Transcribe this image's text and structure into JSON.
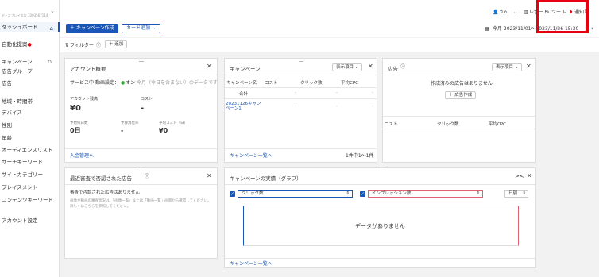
{
  "sidebar": {
    "account_id": "ディスプレイ広告 1003567114",
    "items": [
      {
        "label": "ダッシュボード"
      },
      {
        "label": "自動化提案"
      },
      {
        "label": "キャンペーン"
      },
      {
        "label": "広告グループ"
      },
      {
        "label": "広告"
      },
      {
        "label": "地域・時間帯"
      },
      {
        "label": "デバイス"
      },
      {
        "label": "性別"
      },
      {
        "label": "年齢"
      },
      {
        "label": "オーディエンスリスト"
      },
      {
        "label": "サーチキーワード"
      },
      {
        "label": "サイトカテゴリー"
      },
      {
        "label": "プレイスメント"
      },
      {
        "label": "コンテンツキーワード"
      },
      {
        "label": "アカウント設定"
      }
    ]
  },
  "topbar": {
    "user": "さん",
    "report": "レポート",
    "tools": "ツール",
    "notify": "通知",
    "help": "?"
  },
  "toolbar": {
    "create_campaign": "キャンペーン作成",
    "add_card": "カード追加",
    "date_range": "今月 2023/11/01～2023/11/26 15:30"
  },
  "filter": {
    "label": "フィルター",
    "add": "追加"
  },
  "account_overview": {
    "title": "アカウント概要",
    "status": "サービス中",
    "auto_setting": "動画設定：",
    "auto_on": "オン",
    "note": "今月（今日を含まない）のデータです",
    "balance_label": "アカウント残高",
    "balance": "¥0",
    "cost_label": "コスト",
    "cost": "-",
    "days_label": "予想残日数",
    "days": "0日",
    "consume_label": "予算消化率",
    "consume": "-",
    "avg_label": "平均コスト（日）",
    "avg": "¥0",
    "link": "入金管理へ"
  },
  "campaign_card": {
    "title": "キャンペーン",
    "display_items": "表示項目",
    "headers": [
      "キャンペーン名",
      "コスト",
      "クリック数",
      "平均CPC"
    ],
    "total_label": "合計",
    "row_name": "20231126キャンペーン1",
    "link": "キャンペーン一覧へ",
    "pager": "1件中1～1件"
  },
  "ads_card": {
    "title": "広告",
    "display_items": "表示項目",
    "empty": "作成済みの広告はありません",
    "create": "広告作成",
    "headers": [
      "コスト",
      "クリック数",
      "平均CPC"
    ]
  },
  "rejected_card": {
    "title": "最近審査で否認された広告",
    "empty": "審査で否認された広告はありません",
    "help": "画像や動画の審査状況は、「画像一覧」または「動画一覧」画面から確認してください。詳しくはこちらを参照してください。"
  },
  "performance_card": {
    "title": "キャンペーンの実績（グラフ）",
    "metric1": "クリック数",
    "metric2": "インプレッション数",
    "granularity": "日別",
    "empty": "データがありません",
    "link": "キャンペーン一覧へ",
    "colors": {
      "metric1": "#1a56b8",
      "metric2": "#e0606e"
    }
  }
}
